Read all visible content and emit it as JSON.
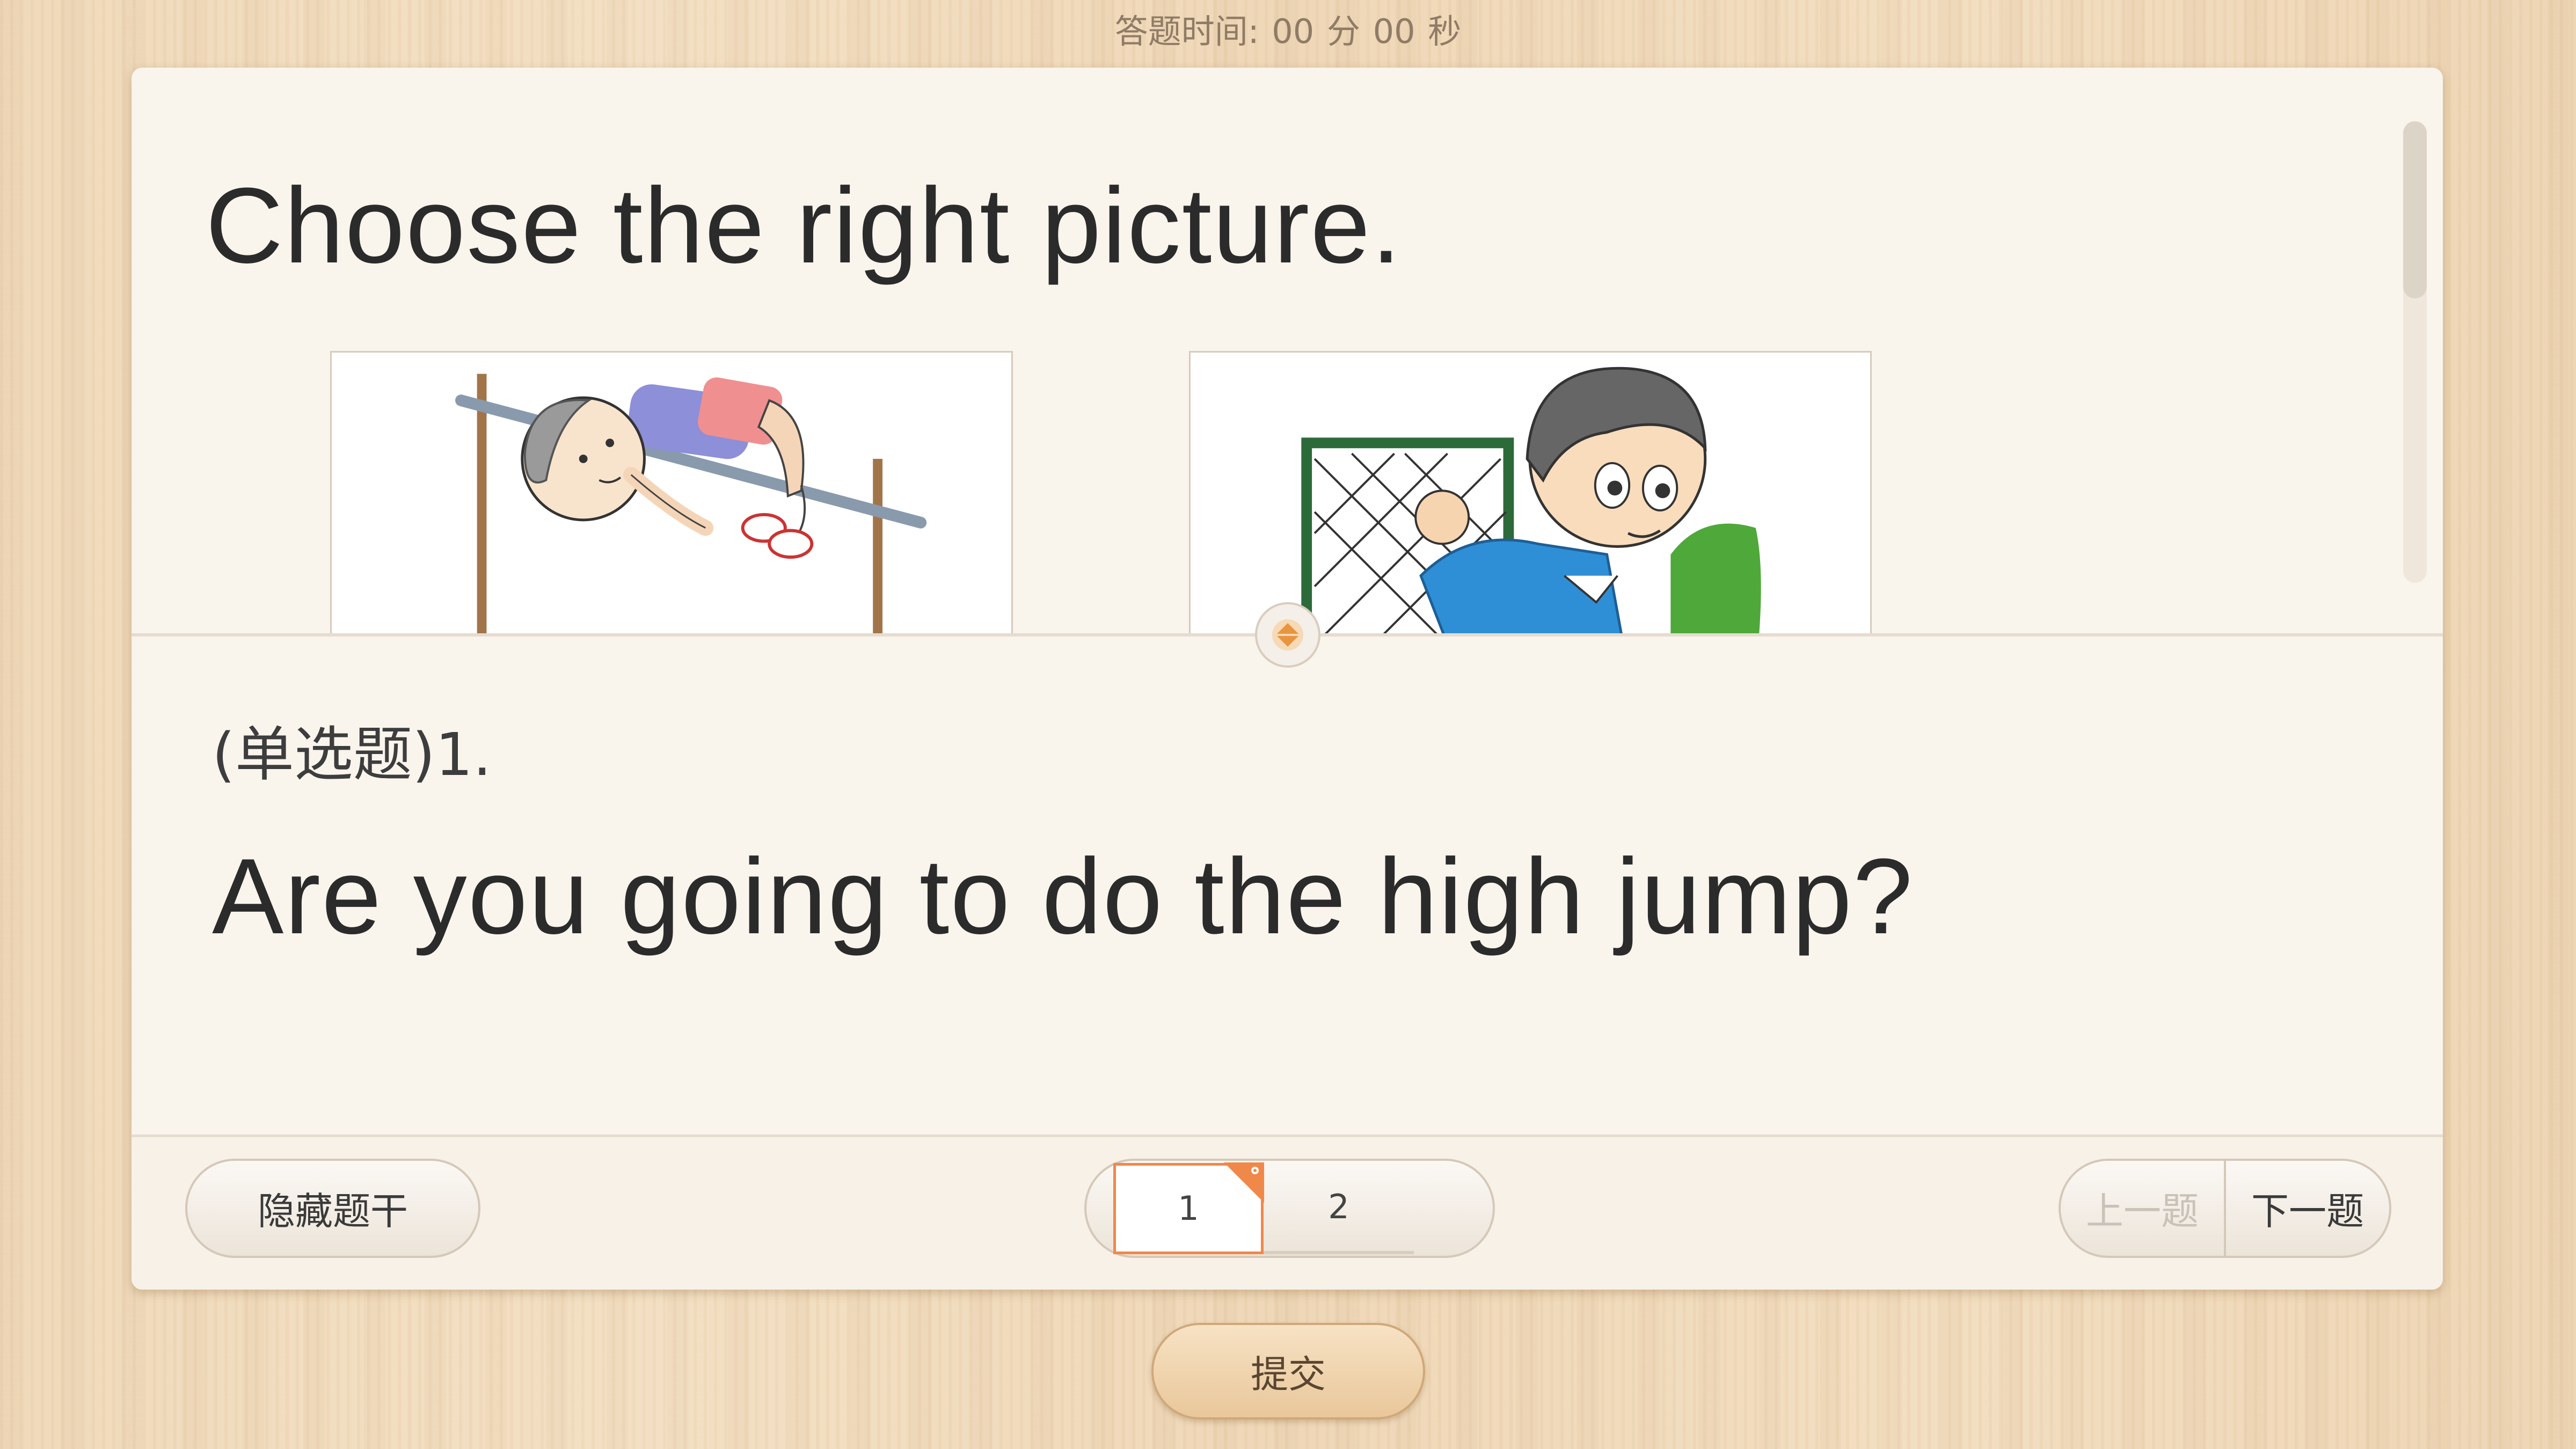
{
  "timer": {
    "label": "答题时间:",
    "minutes": "00",
    "minutes_unit": "分",
    "seconds": "00",
    "seconds_unit": "秒"
  },
  "stem": {
    "instruction": "Choose the right picture.",
    "pictures": [
      {
        "icon": "high-jump-picture"
      },
      {
        "icon": "soccer-goalkeeper-picture"
      }
    ]
  },
  "question": {
    "type_label": "(单选题)",
    "number": "1.",
    "text": "Are you going to do the high jump?"
  },
  "footer": {
    "hide_stem_label": "隐藏题干",
    "pages": [
      "1",
      "2"
    ],
    "current_page": "1",
    "prev_label": "上一题",
    "next_label": "下一题"
  },
  "submit_label": "提交",
  "colors": {
    "accent": "#f0884a",
    "card_bg": "#f9f4ec",
    "text": "#2b2b2b"
  }
}
